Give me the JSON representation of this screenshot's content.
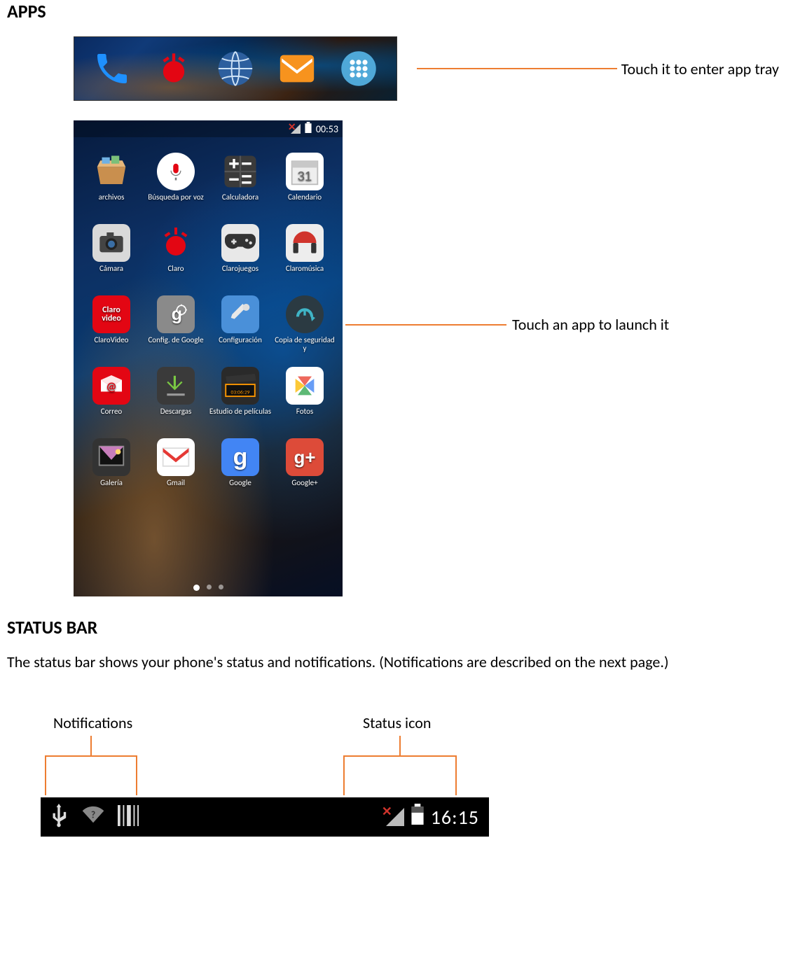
{
  "sections": {
    "apps_title": "APPS",
    "statusbar_title": "STATUS BAR",
    "statusbar_desc": "The status bar shows your phone's status and notifications. (Notifications are described on the next page.)"
  },
  "callouts": {
    "app_tray": "Touch it to enter app tray",
    "launch_app": "Touch an app to launch it",
    "notifications": "Notifications",
    "status_icon": "Status icon"
  },
  "dock": {
    "icons": [
      "phone-icon",
      "claro-icon",
      "browser-icon",
      "messaging-icon",
      "apps-icon"
    ]
  },
  "phone": {
    "status_time": "00:53",
    "apps": [
      {
        "label": "archivos",
        "icon": "files-icon"
      },
      {
        "label": "Búsqueda por voz",
        "icon": "voice-search-icon"
      },
      {
        "label": "Calculadora",
        "icon": "calculator-icon"
      },
      {
        "label": "Calendario",
        "icon": "calendar-icon"
      },
      {
        "label": "Cámara",
        "icon": "camera-icon"
      },
      {
        "label": "Claro",
        "icon": "claro-icon"
      },
      {
        "label": "Clarojuegos",
        "icon": "games-icon"
      },
      {
        "label": "Claromúsica",
        "icon": "music-icon"
      },
      {
        "label": "ClaroVideo",
        "icon": "clarovideo-icon"
      },
      {
        "label": "Config. de Google",
        "icon": "google-settings-icon"
      },
      {
        "label": "Configuración",
        "icon": "settings-icon"
      },
      {
        "label": "Copia de seguridad y",
        "icon": "backup-icon"
      },
      {
        "label": "Correo",
        "icon": "mail-icon"
      },
      {
        "label": "Descargas",
        "icon": "downloads-icon"
      },
      {
        "label": "Estudio de películas",
        "icon": "movie-studio-icon"
      },
      {
        "label": "Fotos",
        "icon": "photos-icon"
      },
      {
        "label": "Galería",
        "icon": "gallery-icon"
      },
      {
        "label": "Gmail",
        "icon": "gmail-icon"
      },
      {
        "label": "Google",
        "icon": "google-icon"
      },
      {
        "label": "Google+",
        "icon": "google-plus-icon"
      }
    ]
  },
  "statusbar": {
    "time": "16:15"
  }
}
